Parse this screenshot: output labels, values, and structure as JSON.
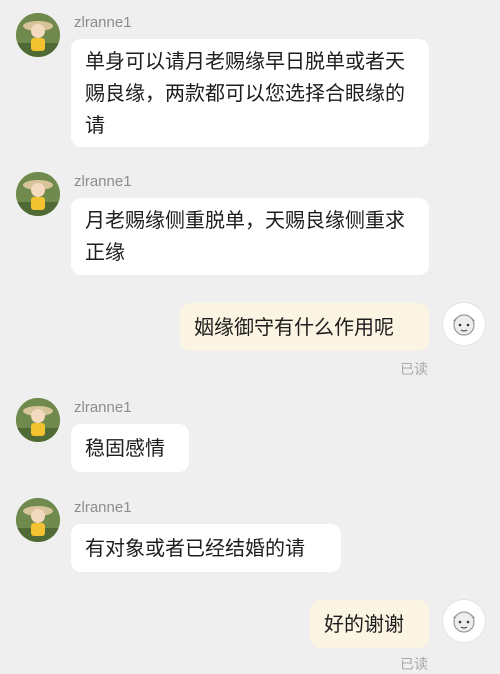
{
  "messages": [
    {
      "sender": "zlranne1",
      "text": "单身可以请月老赐缘早日脱单或者天赐良缘，两款都可以您选择合眼缘的请"
    },
    {
      "sender": "zlranne1",
      "text": "月老赐缘侧重脱单，天赐良缘侧重求正缘"
    },
    {
      "sender": "me",
      "text": "姻缘御守有什么作用呢",
      "status": "已读"
    },
    {
      "sender": "zlranne1",
      "text": "稳固感情"
    },
    {
      "sender": "zlranne1",
      "text": "有对象或者已经结婚的请"
    },
    {
      "sender": "me",
      "text": "好的谢谢",
      "status": "已读"
    }
  ],
  "colors": {
    "background": "#efefef",
    "incoming_bubble": "#ffffff",
    "outgoing_bubble": "#fbf4e2",
    "username": "#8d8d8d",
    "read_status": "#a8a8a8"
  },
  "icons": {
    "left_avatar": "girl-doll-avatar-icon",
    "right_avatar": "cartoon-face-avatar-icon"
  }
}
